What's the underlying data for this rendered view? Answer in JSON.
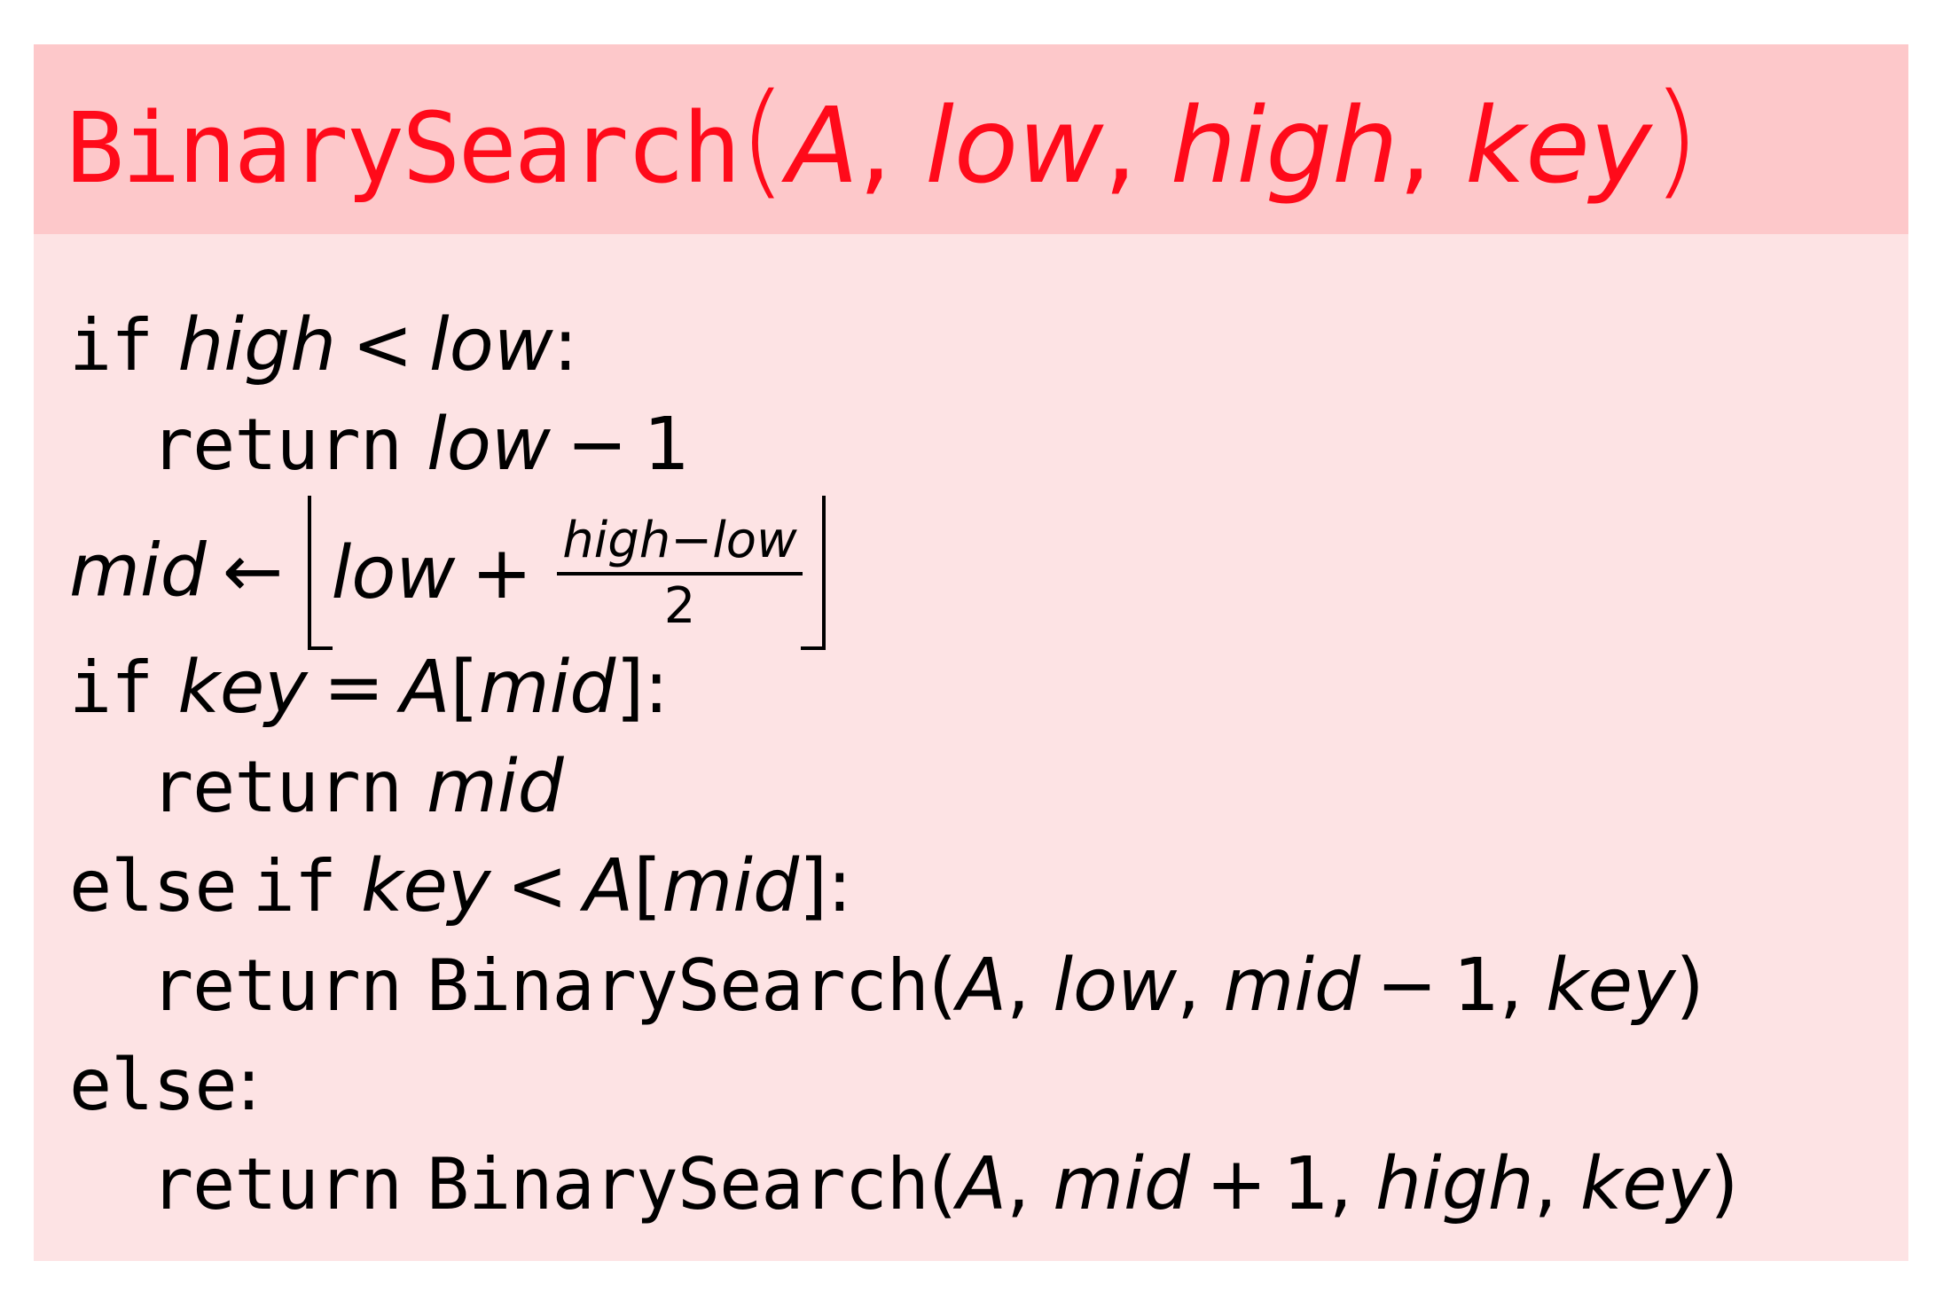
{
  "header": {
    "func_name": "BinarySearch",
    "open_paren": "(",
    "close_paren": ")",
    "params": [
      "A",
      "low",
      "high",
      "key"
    ],
    "sep": ", "
  },
  "code": {
    "line1": {
      "kw": "if",
      "lhs": "high",
      "op": "<",
      "rhs": "low",
      "colon": ":"
    },
    "line2": {
      "kw": "return",
      "lhs": "low",
      "op": "−",
      "rhs": "1"
    },
    "line3": {
      "lhs": "mid",
      "arrow": "←",
      "term": "low",
      "plus": "+",
      "num_a": "high",
      "num_minus": "−",
      "num_b": "low",
      "den": "2"
    },
    "line4": {
      "kw": "if",
      "lhs": "key",
      "op": "=",
      "arr": "A",
      "lb": "[",
      "idx": "mid",
      "rb": "]",
      "colon": ":"
    },
    "line5": {
      "kw": "return",
      "val": "mid"
    },
    "line6": {
      "kw1": "else",
      "kw2": "if",
      "lhs": "key",
      "op": "<",
      "arr": "A",
      "lb": "[",
      "idx": "mid",
      "rb": "]",
      "colon": ":"
    },
    "line7": {
      "kw": "return",
      "fn": "BinarySearch",
      "open": "(",
      "a1": "A",
      "a2": "low",
      "a3": "mid",
      "minus": "−",
      "one": "1",
      "a4": "key",
      "close": ")",
      "comma": ", "
    },
    "line8": {
      "kw": "else",
      "colon": ":"
    },
    "line9": {
      "kw": "return",
      "fn": "BinarySearch",
      "open": "(",
      "a1": "A",
      "a2": "mid",
      "plus": "+",
      "one": "1",
      "a3": "high",
      "a4": "key",
      "close": ")",
      "comma": ", "
    }
  },
  "colors": {
    "title": "#ff0a1a",
    "header_bg": "#fdc8ca",
    "body_bg": "#fde3e4",
    "text": "#000000"
  }
}
